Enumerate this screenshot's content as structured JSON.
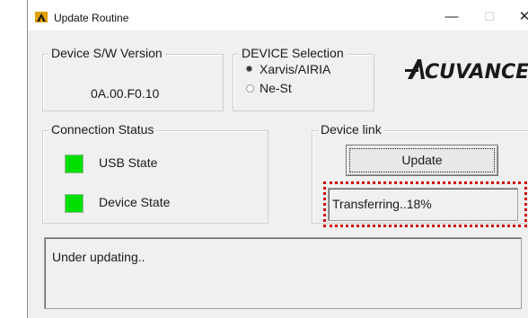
{
  "window": {
    "title": "Update Routine",
    "minimize_glyph": "—",
    "maximize_glyph": "☐",
    "close_glyph": "✕"
  },
  "version_group": {
    "label": "Device S/W Version",
    "value": "0A.00.F0.10"
  },
  "device_selection": {
    "label": "DEVICE Selection",
    "options": [
      {
        "label": "Xarvis/AIRIA",
        "selected": true
      },
      {
        "label": "Ne-St",
        "selected": false
      }
    ]
  },
  "logo": {
    "text": "ACUVANCE"
  },
  "connection_status": {
    "label": "Connection Status",
    "items": [
      {
        "label": "USB State",
        "status_color": "#00e000"
      },
      {
        "label": "Device State",
        "status_color": "#00e000"
      }
    ]
  },
  "device_link": {
    "label": "Device link",
    "update_button": "Update",
    "status": "Transferring..18%"
  },
  "message": "Under updating..",
  "colors": {
    "window_bg": "#f0f0f0",
    "led_on": "#00e000",
    "highlight": "#d40000"
  }
}
